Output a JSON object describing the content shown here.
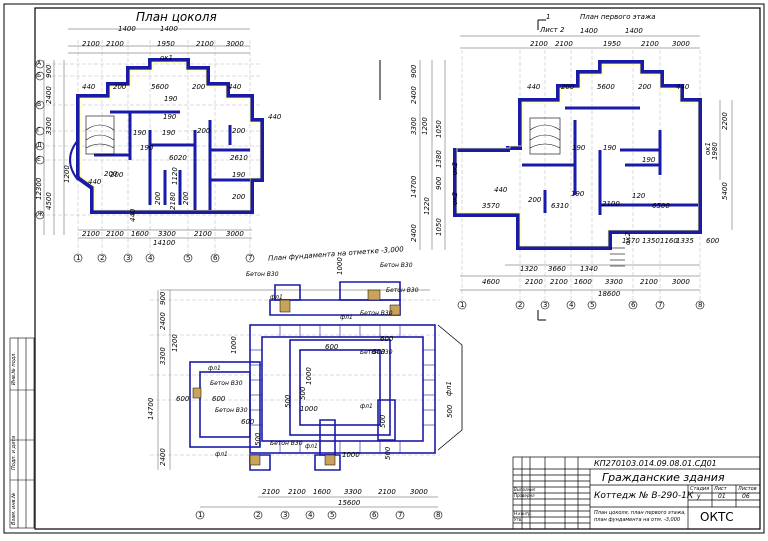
{
  "plan_basement": {
    "title": "План цоколя",
    "top_dims_1": [
      "1400",
      "1400"
    ],
    "top_dims_2": [
      "2100",
      "2100",
      "1950",
      "2100",
      "3000"
    ],
    "top_dims_3": [
      "1950"
    ],
    "room_dims": [
      "ок1",
      "440",
      "200",
      "5600",
      "200",
      "440",
      "190",
      "190",
      "190",
      "190",
      "200",
      "200",
      "440",
      "440",
      "6020",
      "2610",
      "190",
      "190",
      "200",
      "200",
      "2180",
      "1120",
      "200",
      "200"
    ],
    "left_dims": [
      "900",
      "2400",
      "3300",
      "1200",
      "12300",
      "4500",
      "440",
      "200"
    ],
    "bottom_dims_1": [
      "2100",
      "2100",
      "1600",
      "3300",
      "2100",
      "3000"
    ],
    "bottom_total": "14100",
    "axes": [
      "1",
      "2",
      "3",
      "4",
      "5",
      "6",
      "7",
      "8",
      "А",
      "Б",
      "В",
      "Г",
      "Д",
      "Е",
      "Ж"
    ]
  },
  "plan_first_floor": {
    "title": "План первого этажа",
    "section_mark": "1",
    "sheet_ref": "Лист 2",
    "top_dims_1": [
      "1400",
      "1400"
    ],
    "top_dims_2": [
      "2100",
      "2100",
      "1950",
      "2100",
      "3000"
    ],
    "room_dims": [
      "440",
      "200",
      "5600",
      "200",
      "440",
      "190",
      "190",
      "190",
      "190",
      "120",
      "440",
      "3570",
      "200",
      "6310",
      "2100",
      "6500",
      "ок1",
      "1980",
      "2200",
      "5400",
      "ок2",
      "ок2",
      "ок2"
    ],
    "left_dims": [
      "900",
      "2400",
      "3300",
      "1200",
      "1050",
      "1380",
      "900",
      "14700",
      "1220",
      "2400",
      "1050"
    ],
    "bottom_dims_1": [
      "1320",
      "3660",
      "1340",
      "1570",
      "1350",
      "1160",
      "1335",
      "600"
    ],
    "bottom_dims_2": [
      "4600",
      "2100",
      "2100",
      "1600",
      "3300",
      "2100",
      "3000"
    ],
    "bottom_total": "18600",
    "axes": [
      "1",
      "2",
      "3",
      "4",
      "5",
      "6",
      "7",
      "8"
    ]
  },
  "plan_foundation": {
    "title": "План фундамента на отметке -3,000",
    "concrete_labels": [
      "Бетон В30",
      "Бетон В30",
      "Бетон В30",
      "Бетон В30",
      "Бетон В30",
      "Бетон В30",
      "Бетон В30",
      "Бетон В30"
    ],
    "blocks": [
      "фл1",
      "фл1",
      "фл1",
      "фл1",
      "фл1",
      "фл1",
      "фл1"
    ],
    "dims": [
      "1000",
      "600",
      "600",
      "1000",
      "600",
      "500",
      "1000",
      "500",
      "600",
      "600",
      "500",
      "500",
      "500",
      "1000",
      "500",
      "600",
      "1000"
    ],
    "left_dims": [
      "900",
      "2400",
      "3300",
      "1200",
      "14700",
      "2400"
    ],
    "bottom_dims_1": [
      "2100",
      "2100",
      "1600",
      "3300",
      "2100",
      "3000"
    ],
    "bottom_total": "15600",
    "axes": [
      "1",
      "2",
      "3",
      "4",
      "5",
      "6",
      "7",
      "8"
    ]
  },
  "title_block": {
    "doc_code": "КП270103.014.09.08.01.СД01",
    "project": "Гражданские здания",
    "building": "Коттедж № В-290-1К",
    "sheet_desc_1": "План цоколя, план первого этажа,",
    "sheet_desc_2": "план фундамента на отм. -3,000",
    "stage_label": "Стадия",
    "sheet_label": "Лист",
    "sheets_label": "Листов",
    "stage": "у",
    "sheet": "01",
    "sheets": "06",
    "org": "ОКТС",
    "rows": [
      "Выполнил",
      "Проверил",
      "Н.контр.",
      "Утв."
    ]
  },
  "side_stamp": {
    "labels": [
      "Инв.№ подл.",
      "Подп. и дата",
      "Взам. инв.№"
    ]
  }
}
